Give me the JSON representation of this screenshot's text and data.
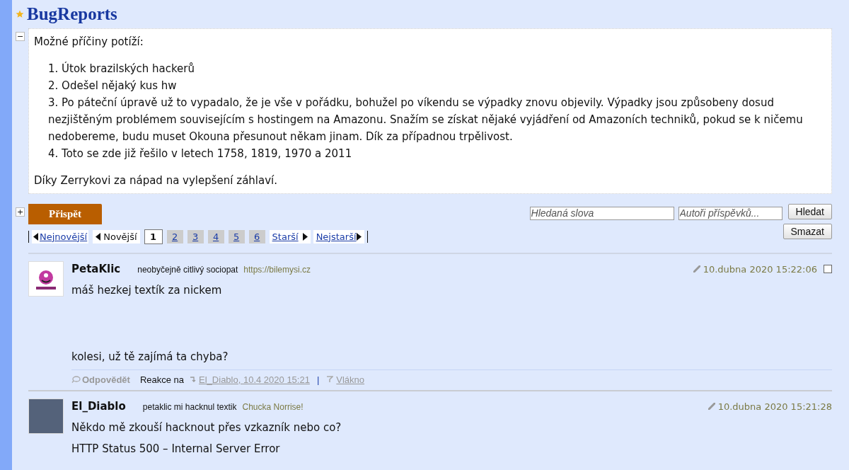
{
  "forum": {
    "title": "BugReports"
  },
  "header": {
    "expanded": true,
    "toggle": "−",
    "intro": "Možné příčiny potíží:",
    "items": [
      "1. Útok brazilských hackerů",
      "2. Odešel nějaký kus hw",
      "3. Po páteční úpravě už to vypadalo, že je vše v pořádku, bohužel po víkendu se výpadky znovu objevily. Výpadky jsou způsobeny dosud nezjištěným problémem souvisejícím s hostingem na Amazonu. Snažím se získat nějaké vyjádření od Amazoních techniků, pokud se k ničemu nedobereme, budu muset Okouna přesunout někam jinam. Dík za případnou trpělivost.",
      "4. Toto se zde již řešilo v letech 1758, 1819, 1970 a 2011"
    ],
    "outro": "Díky Zerrykovi za nápad na vylepšení záhlaví."
  },
  "toolbar": {
    "post_toggle": "+",
    "post_button": "Přispět",
    "search_placeholder": "Hledaná slova",
    "authors_placeholder": "Autoři příspěvků...",
    "search_button": "Hledat",
    "clear_button": "Smazat"
  },
  "pagination": {
    "newest": "Nejnovější",
    "newer": "Novější",
    "older": "Starší",
    "oldest": "Nejstarší",
    "pages": [
      {
        "label": "1",
        "selected": true
      },
      {
        "label": "2",
        "selected": false
      },
      {
        "label": "3",
        "selected": false
      },
      {
        "label": "4",
        "selected": false
      },
      {
        "label": "5",
        "selected": false
      },
      {
        "label": "6",
        "selected": false
      }
    ]
  },
  "posts": [
    {
      "author": "PetaKlic",
      "motto": "neobyčejně citlivý sociopat",
      "link": "https://bilemysi.cz",
      "date": "10.dubna 2020 15:22:06",
      "checked": false,
      "body": [
        "máš hezkej textík za nickem",
        "kolesi, už tě zajímá ta chyba?"
      ],
      "footer": {
        "reply": "Odpovědět",
        "reaction_label": "Reakce na",
        "reaction_link": "El_Diablo, 10.4 2020 15:21",
        "separator": "|",
        "thread": "Vlákno"
      }
    },
    {
      "author": "El_Diablo",
      "motto": "petaklic mi hacknul textik",
      "link": "Chucka Norrise!",
      "date": "10.dubna 2020 15:21:28",
      "body": [
        "Někdo mě zkouší hacknout přes vzkazník nebo co?",
        "HTTP Status 500 – Internal Server Error"
      ]
    }
  ]
}
